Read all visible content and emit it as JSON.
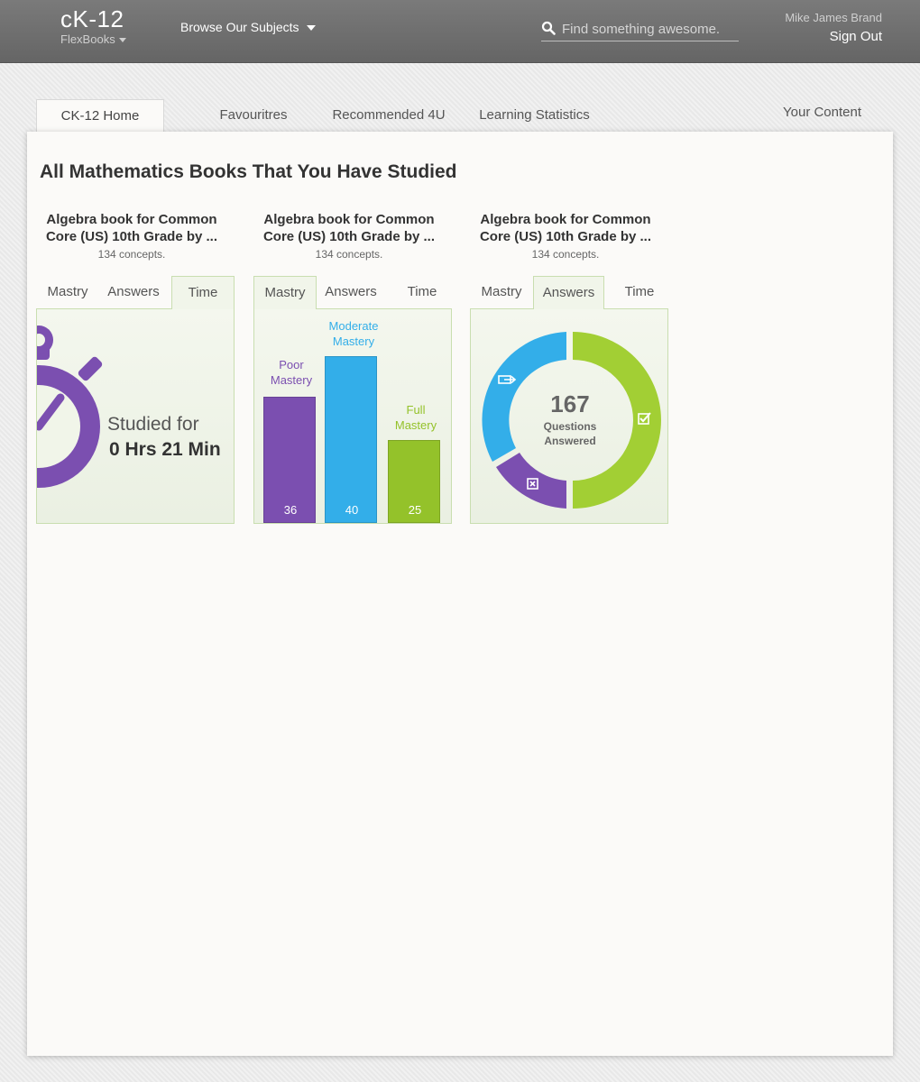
{
  "header": {
    "logo": "cK-12",
    "logo_sub": "FlexBooks",
    "browse_label": "Browse Our Subjects",
    "search_placeholder": "Find something awesome.",
    "user_name": "Mike James Brand",
    "sign_out": "Sign Out"
  },
  "tabs": [
    {
      "label": "CK-12 Home",
      "active": true
    },
    {
      "label": "Favouritres",
      "active": false
    },
    {
      "label": "Recommended 4U",
      "active": false
    },
    {
      "label": "Learning Statistics",
      "active": false
    }
  ],
  "your_content": "Your Content",
  "panel_title": "All Mathematics Books That You Have Studied",
  "card_tabs": [
    "Mastry",
    "Answers",
    "Time"
  ],
  "cards": [
    {
      "title": "Algebra book for Common Core (US) 10th Grade by ...",
      "concepts": "134 concepts.",
      "active_tab": "Time",
      "studied_label": "Studied for",
      "studied_value": "0 Hrs 21 Min"
    },
    {
      "title": "Algebra book for Common Core (US) 10th Grade by ...",
      "concepts": "134 concepts.",
      "active_tab": "Mastry",
      "bars": [
        {
          "label_line1": "Poor",
          "label_line2": "Mastery",
          "value": "36",
          "color": "#7b4fb0"
        },
        {
          "label_line1": "Moderate",
          "label_line2": "Mastery",
          "value": "40",
          "color": "#33aee9"
        },
        {
          "label_line1": "Full",
          "label_line2": "Mastery",
          "value": "25",
          "color": "#94c22a"
        }
      ]
    },
    {
      "title": "Algebra book for Common Core (US) 10th Grade by ...",
      "concepts": "134 concepts.",
      "active_tab": "Answers",
      "total": "167",
      "center_line1": "Questions",
      "center_line2": "Answered"
    }
  ],
  "colors": {
    "purple": "#7b4fb0",
    "blue": "#33aee9",
    "green": "#a2cf34"
  }
}
